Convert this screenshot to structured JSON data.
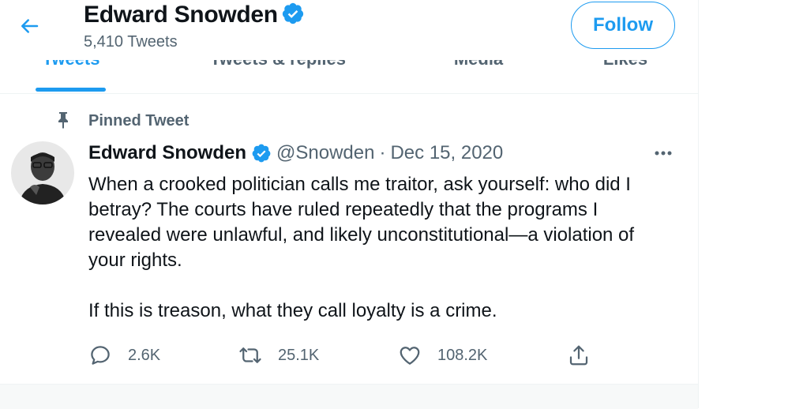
{
  "header": {
    "title": "Edward Snowden",
    "tweet_count": "5,410 Tweets",
    "follow_label": "Follow"
  },
  "tabs": [
    {
      "label": "Tweets",
      "active": true
    },
    {
      "label": "Tweets & replies",
      "active": false
    },
    {
      "label": "Media",
      "active": false
    },
    {
      "label": "Likes",
      "active": false
    }
  ],
  "tweet": {
    "pinned_label": "Pinned Tweet",
    "author_name": "Edward Snowden",
    "handle": "@Snowden",
    "separator": "·",
    "date": "Dec 15, 2020",
    "paragraph1": "When a crooked politician calls me traitor, ask yourself: who did I betray? The courts have ruled repeatedly that the programs I revealed were unlawful, and likely unconstitutional—a violation of your rights.",
    "paragraph2": "If this is treason, what they call loyalty is a crime.",
    "replies": "2.6K",
    "retweets": "25.1K",
    "likes": "108.2K"
  },
  "colors": {
    "accent": "#1d9bf0",
    "text": "#0f1419",
    "muted": "#536471"
  },
  "icons": [
    "back-arrow-icon",
    "verified-badge-icon",
    "pin-icon",
    "more-options-icon",
    "reply-icon",
    "retweet-icon",
    "like-icon",
    "share-icon"
  ]
}
